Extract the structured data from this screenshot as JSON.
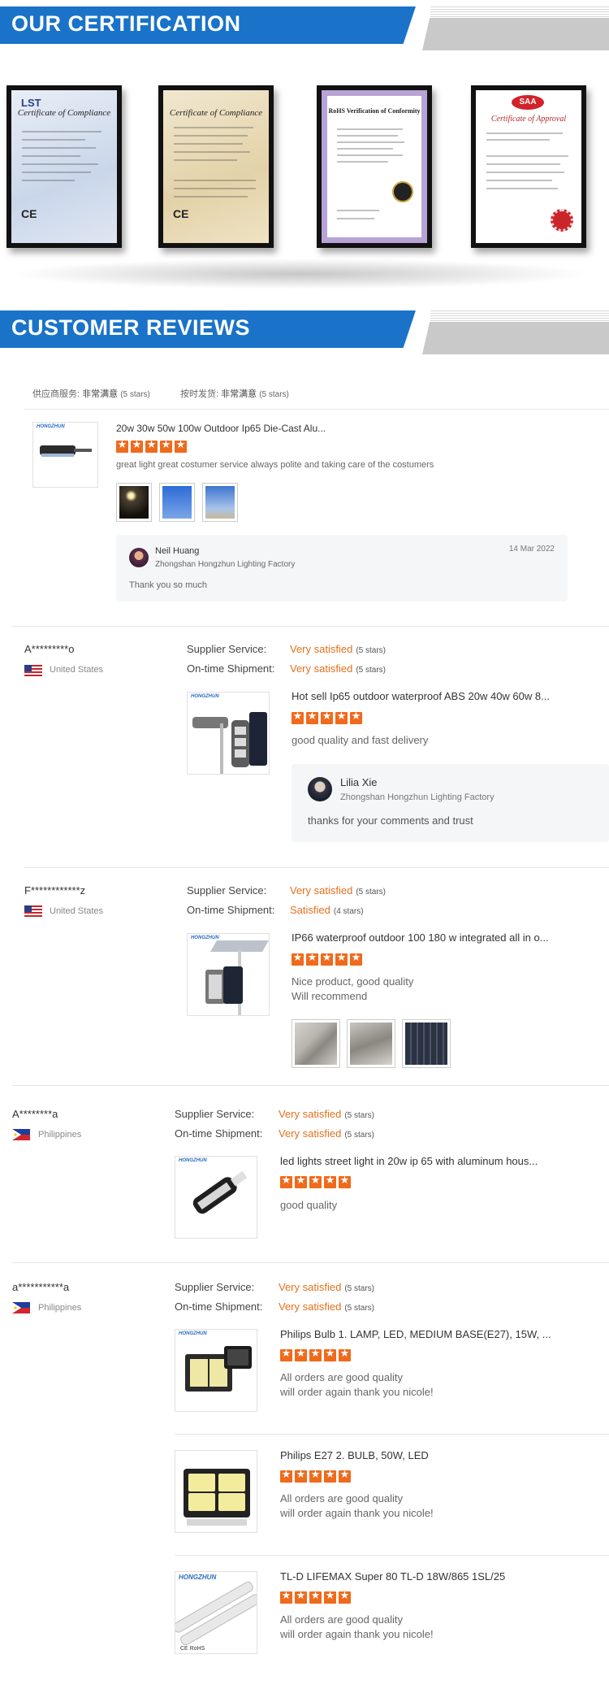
{
  "certification": {
    "title": "OUR CERTIFICATION",
    "certs": [
      {
        "logo": "LST",
        "title": "Certificate of Compliance",
        "mark": "CE"
      },
      {
        "logo": "",
        "title": "Certificate of Compliance",
        "mark": "CE"
      },
      {
        "logo": "",
        "title": "RoHS Verification of Conformity",
        "mark": ""
      },
      {
        "logo": "SAA",
        "title": "Certificate of Approval",
        "mark": ""
      }
    ]
  },
  "reviews": {
    "title": "CUSTOMER REVIEWS",
    "summary": {
      "service_label": "供应商服务:",
      "service_value": "非常满意",
      "service_stars": "(5 stars)",
      "shipment_label": "按时发货:",
      "shipment_value": "非常满意",
      "shipment_stars": "(5 stars)"
    },
    "first": {
      "product": "20w 30w 50w 100w Outdoor Ip65 Die-Cast Alu...",
      "brand": "HONGZHUN",
      "text": "great light great costumer service always polite and taking care of the costumers",
      "reply_name": "Neil Huang",
      "reply_company": "Zhongshan Hongzhun Lighting Factory",
      "reply_date": "14 Mar 2022",
      "reply_text": "Thank you so much"
    },
    "labels": {
      "supplier": "Supplier Service:",
      "shipment": "On-time Shipment:"
    },
    "r2": {
      "buyer": "A*********o",
      "country": "United States",
      "supplier_value": "Very satisfied",
      "supplier_stars": "(5 stars)",
      "shipment_value": "Very satisfied",
      "shipment_stars": "(5 stars)",
      "product": "Hot sell Ip65 outdoor waterproof ABS 20w 40w 60w 8...",
      "brand": "HONGZHUN",
      "text": "good quality and fast delivery",
      "reply_name": "Lilia Xie",
      "reply_company": "Zhongshan Hongzhun Lighting Factory",
      "reply_text": "thanks for your comments and trust"
    },
    "r3": {
      "buyer": "F************z",
      "country": "United States",
      "supplier_value": "Very satisfied",
      "supplier_stars": "(5 stars)",
      "shipment_value": "Satisfied",
      "shipment_stars": "(4 stars)",
      "product": "IP66 waterproof outdoor 100 180 w integrated all in o...",
      "brand": "HONGZHUN",
      "text1": "Nice product, good quality",
      "text2": "Will recommend"
    },
    "r4": {
      "buyer": "A********a",
      "country": "Philippines",
      "supplier_value": "Very satisfied",
      "supplier_stars": "(5 stars)",
      "shipment_value": "Very satisfied",
      "shipment_stars": "(5 stars)",
      "product": "led lights street light in 20w ip 65 with aluminum hous...",
      "brand": "HONGZHUN",
      "text": "good quality"
    },
    "r5": {
      "buyer": "a***********a",
      "country": "Philippines",
      "supplier_value": "Very satisfied",
      "supplier_stars": "(5 stars)",
      "shipment_value": "Very satisfied",
      "shipment_stars": "(5 stars)",
      "items": [
        {
          "product": "Philips Bulb 1. LAMP, LED, MEDIUM BASE(E27), 15W, ...",
          "brand": "HONGZHUN",
          "text1": "All orders are good quality",
          "text2": "will order again thank you nicole!"
        },
        {
          "product": "Philips E27 2. BULB, 50W, LED",
          "brand": "",
          "text1": "All orders are good quality",
          "text2": "will order again thank you nicole!"
        },
        {
          "product": "TL-D LIFEMAX Super 80 TL-D 18W/865 1SL/25",
          "brand": "HONGZHUN",
          "text1": "All orders are good quality",
          "text2": "will order again thank you nicole!"
        }
      ]
    }
  },
  "colors": {
    "banner_blue": "#1a73c8",
    "rating_orange": "#e4701e",
    "star_orange": "#f06a1c"
  }
}
